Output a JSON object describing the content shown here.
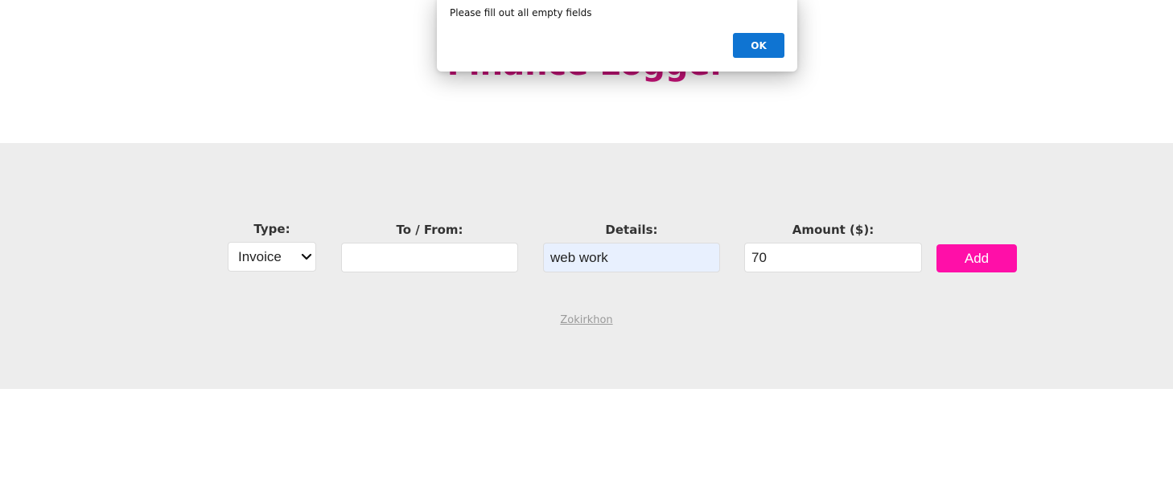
{
  "header": {
    "title": "Finance Logger"
  },
  "form": {
    "type": {
      "label": "Type:",
      "selected": "Invoice"
    },
    "to_from": {
      "label": "To / From:",
      "value": ""
    },
    "details": {
      "label": "Details:",
      "value": "web work"
    },
    "amount": {
      "label": "Amount ($):",
      "value": "70"
    },
    "add_label": "Add"
  },
  "footer": {
    "credit": "Zokirkhon"
  },
  "alert": {
    "message": "Please fill out all empty fields",
    "ok_label": "OK"
  },
  "colors": {
    "title": "#c51378",
    "add_button": "#ff0fa8",
    "band": "#ededed",
    "ok_button": "#0f74d2",
    "autofill": "#e8f0fe"
  },
  "icons": {
    "select_arrow": "chevron-down-icon"
  }
}
